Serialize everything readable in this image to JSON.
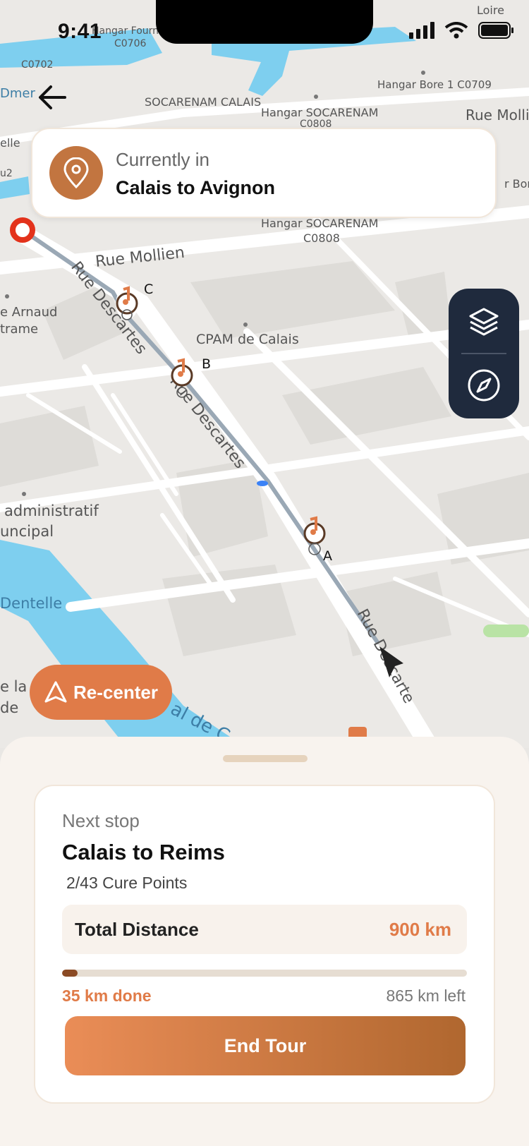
{
  "status_bar": {
    "time": "9:41"
  },
  "map": {
    "street_labels": [
      "Rue Mollien",
      "Rue Descartes",
      "Rue Descartes",
      "Rue Descartes",
      "Rue Mollie",
      "SOCARENAM CALAIS",
      "Hangar SOCARENAM",
      "C0808",
      "Hangar SOCARENAM",
      "C0808",
      "Hangar Fourni",
      "C0706",
      "Hangar Bore 1 C0709",
      "C0702",
      "CPAM de Calais",
      "e Arnaud",
      "trame",
      "administratif",
      "uncipal",
      "Dentelle",
      "e la",
      "de",
      "al de C",
      "elle",
      "u2",
      "Loire",
      "Dmer",
      "r Bore"
    ],
    "stops": [
      {
        "label": "C"
      },
      {
        "label": "B"
      },
      {
        "label": "A"
      }
    ]
  },
  "location_card": {
    "label": "Currently in",
    "value": "Calais to Avignon"
  },
  "recenter": {
    "label": "Re-center"
  },
  "next_stop": {
    "label": "Next stop",
    "value": "Calais to Reims",
    "points": "2/43 Cure Points",
    "distance_label": "Total Distance",
    "distance_value": "900 km",
    "progress_fraction": 0.039,
    "done_text": "35 km done",
    "left_text": "865 km left",
    "end_button": "End Tour"
  },
  "colors": {
    "accent": "#e07b48",
    "brand_brown": "#c27540",
    "dark_panel": "#1f2a3d"
  }
}
